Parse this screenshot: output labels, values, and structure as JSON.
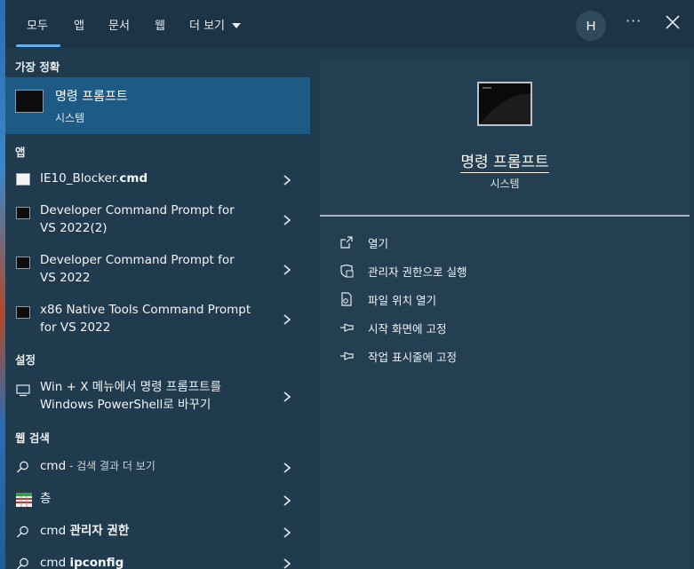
{
  "tabs": [
    "모두",
    "앱",
    "문서",
    "웹",
    "더 보기"
  ],
  "user": {
    "initial": "H"
  },
  "sections": {
    "best": "가장 정확",
    "apps": "앱",
    "settings": "설정",
    "web": "웹 검색"
  },
  "best_match": {
    "title": "명령 프롬프트",
    "subtitle": "시스템"
  },
  "apps": [
    {
      "pre": "IE10_Blocker.",
      "bold": "cmd",
      "line2": "",
      "icon": "file-icon"
    },
    {
      "pre": "Developer Command Prompt for",
      "bold": "",
      "line2": "VS 2022(2)",
      "icon": "cmd-icon"
    },
    {
      "pre": "Developer Command Prompt for",
      "bold": "",
      "line2": "VS 2022",
      "icon": "cmd-icon"
    },
    {
      "pre": "x86 Native Tools Command Prompt",
      "bold": "",
      "line2": "for VS 2022",
      "icon": "cmd-icon"
    }
  ],
  "settings": [
    {
      "line1": "Win + X 메뉴에서 명령 프롬프트를",
      "line2": "Windows PowerShell로 바꾸기",
      "icon": "monitor-icon"
    }
  ],
  "web": [
    {
      "pre": "cmd",
      "bold": "",
      "muted": " - 검색 결과 더 보기",
      "icon": "search-icon"
    },
    {
      "pre": "층",
      "bold": "",
      "muted": "",
      "icon": "grid-icon"
    },
    {
      "pre": "cmd ",
      "bold": "관리자 권한",
      "muted": "",
      "icon": "search-icon"
    },
    {
      "pre": "cmd ",
      "bold": "ipconfig",
      "muted": "",
      "icon": "search-icon"
    }
  ],
  "preview": {
    "title": "명령 프롬프트",
    "subtitle": "시스템"
  },
  "actions": [
    {
      "label": "열기",
      "icon": "open-icon"
    },
    {
      "label": "관리자 권한으로 실행",
      "icon": "shield-icon"
    },
    {
      "label": "파일 위치 열기",
      "icon": "file-location-icon"
    },
    {
      "label": "시작 화면에 고정",
      "icon": "pin-icon"
    },
    {
      "label": "작업 표시줄에 고정",
      "icon": "pin-icon"
    }
  ],
  "colors": {
    "accent": "#5fb2f2",
    "selected": "#1e5a86",
    "background": "#203b4d"
  }
}
